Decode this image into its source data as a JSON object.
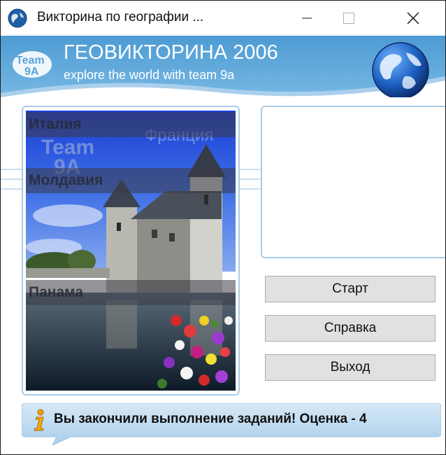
{
  "window": {
    "title": "Викторина по географии ..."
  },
  "banner": {
    "logo_text_top": "Team",
    "logo_text_bottom": "9A",
    "heading": "ГЕОВИКТОРИНА 2006",
    "subheading": "explore the world with team 9a"
  },
  "photo": {
    "watermark_top": "Team",
    "watermark_bottom": "9A",
    "ghost_country": "Франция",
    "answers": [
      "Италия",
      "Молдавия",
      "Панама"
    ]
  },
  "buttons": {
    "start": "Старт",
    "help": "Справка",
    "exit": "Выход"
  },
  "status": {
    "icon": "info-icon",
    "message": "Вы закончили выполнение заданий! Оценка - 4"
  },
  "colors": {
    "banner_blue": "#5aa6d8",
    "panel_border": "#a9cbe8",
    "button_face": "#e1e1e1",
    "status_blue": "#bcd9f0"
  }
}
